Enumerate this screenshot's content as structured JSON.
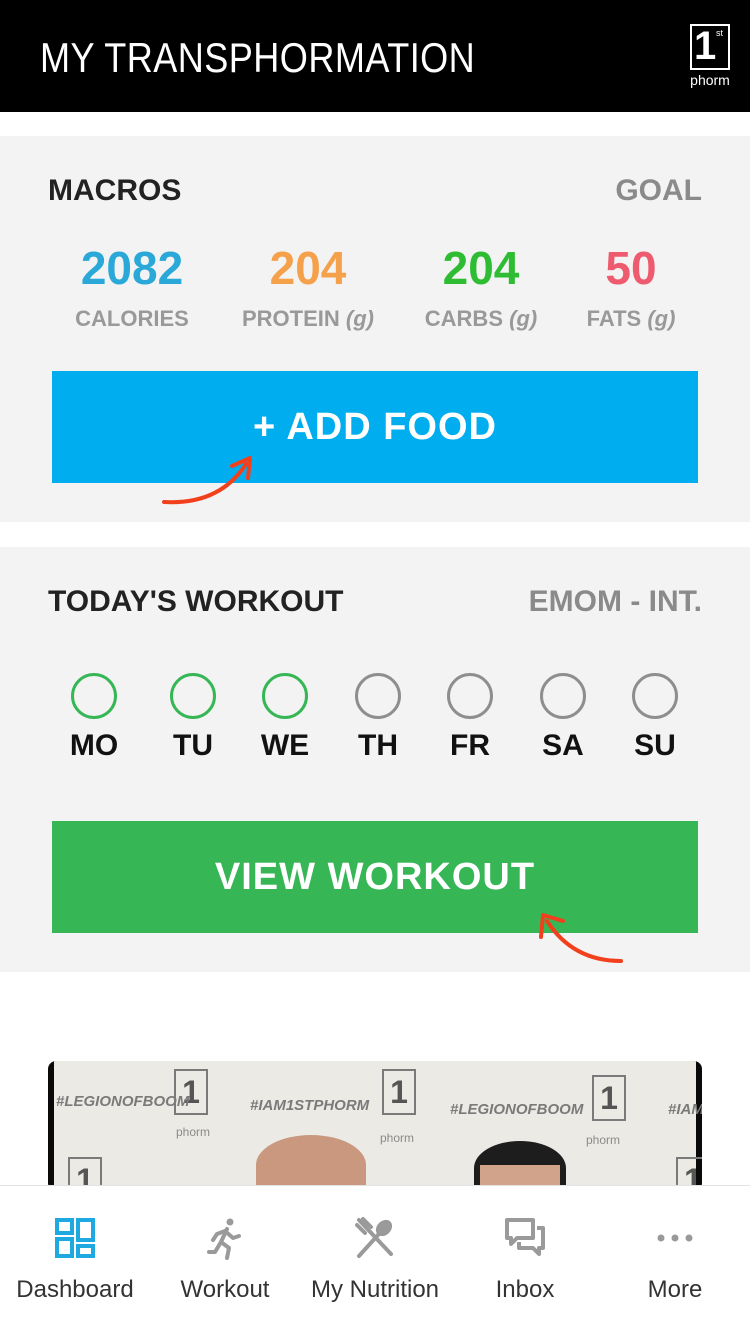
{
  "header": {
    "title": "MY TRANSPHORMATION",
    "logo": {
      "number": "1",
      "superscript": "st",
      "word": "phorm"
    }
  },
  "macros": {
    "heading": "MACROS",
    "side_label": "GOAL",
    "items": [
      {
        "value": "2082",
        "label": "CALORIES",
        "unit": "",
        "color": "#2aa8d8"
      },
      {
        "value": "204",
        "label": "PROTEIN",
        "unit": "(g)",
        "color": "#f5a04a"
      },
      {
        "value": "204",
        "label": "CARBS",
        "unit": "(g)",
        "color": "#2ebd32"
      },
      {
        "value": "50",
        "label": "FATS",
        "unit": "(g)",
        "color": "#ee5a6e"
      }
    ],
    "button_label": "+ ADD FOOD"
  },
  "workout": {
    "heading": "TODAY'S WORKOUT",
    "side_label": "EMOM - INT.",
    "days": [
      {
        "label": "MO",
        "done": true
      },
      {
        "label": "TU",
        "done": true
      },
      {
        "label": "WE",
        "done": true
      },
      {
        "label": "TH",
        "done": false
      },
      {
        "label": "FR",
        "done": false
      },
      {
        "label": "SA",
        "done": false
      },
      {
        "label": "SU",
        "done": false
      }
    ],
    "button_label": "VIEW WORKOUT"
  },
  "media": {
    "tags": [
      "#LEGIONOFBOOM",
      "#IAM1STPHORM",
      "#LEGIONOFBOOM",
      "#IAM"
    ],
    "logo_word": "phorm"
  },
  "tabs": [
    {
      "label": "Dashboard",
      "icon": "dashboard-icon",
      "active": true
    },
    {
      "label": "Workout",
      "icon": "runner-icon",
      "active": false
    },
    {
      "label": "My Nutrition",
      "icon": "utensils-icon",
      "active": false
    },
    {
      "label": "Inbox",
      "icon": "chat-bubbles-icon",
      "active": false
    },
    {
      "label": "More",
      "icon": "more-dots-icon",
      "active": false
    }
  ],
  "colors": {
    "accent_blue": "#00aeef",
    "accent_green": "#36b655",
    "annotation_arrow": "#f2401d",
    "tab_active": "#1ea9e1",
    "tab_inactive": "#9a9a9a"
  }
}
